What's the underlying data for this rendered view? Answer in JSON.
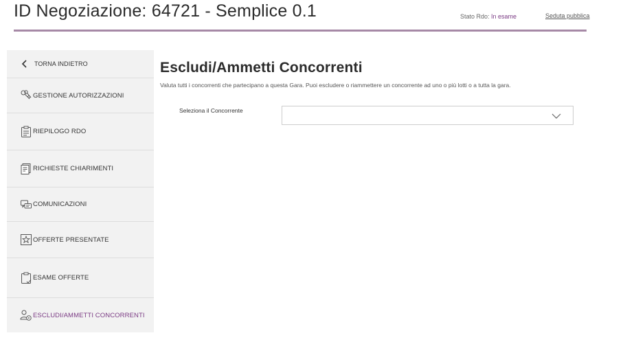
{
  "header": {
    "title": "ID Negoziazione: 64721 - Semplice 0.1",
    "status_label": "Stato Rdo: ",
    "status_value": "In esame",
    "link": "Seduta pubblica"
  },
  "sidebar": {
    "back_label": "TORNA INDIETRO",
    "items": [
      {
        "label": "GESTIONE AUTORIZZAZIONI",
        "icon": "keys-icon"
      },
      {
        "label": "RIEPILOGO RDO",
        "icon": "clipboard-list-icon"
      },
      {
        "label": "RICHIESTE CHIARIMENTI",
        "icon": "documents-question-icon"
      },
      {
        "label": "COMUNICAZIONI",
        "icon": "chat-bubbles-icon"
      },
      {
        "label": "OFFERTE PRESENTATE",
        "icon": "document-star-icon"
      },
      {
        "label": "ESAME OFFERTE",
        "icon": "clipboard-check-icon"
      },
      {
        "label": "ESCLUDI/AMMETTI CONCORRENTI",
        "icon": "users-settings-icon",
        "active": true
      }
    ]
  },
  "main": {
    "title": "Escludi/Ammetti Concorrenti",
    "description": "Valuta tutti i concorrenti che partecipano a questa Gara. Puoi escludere o riammettere un concorrente ad uno o più lotti o a tutta la gara.",
    "field_label": "Seleziona il Concorrente",
    "select_value": ""
  },
  "colors": {
    "accent": "#7a3a83",
    "rule": "#a689a6",
    "sidebar_bg": "#f2f2f2"
  }
}
